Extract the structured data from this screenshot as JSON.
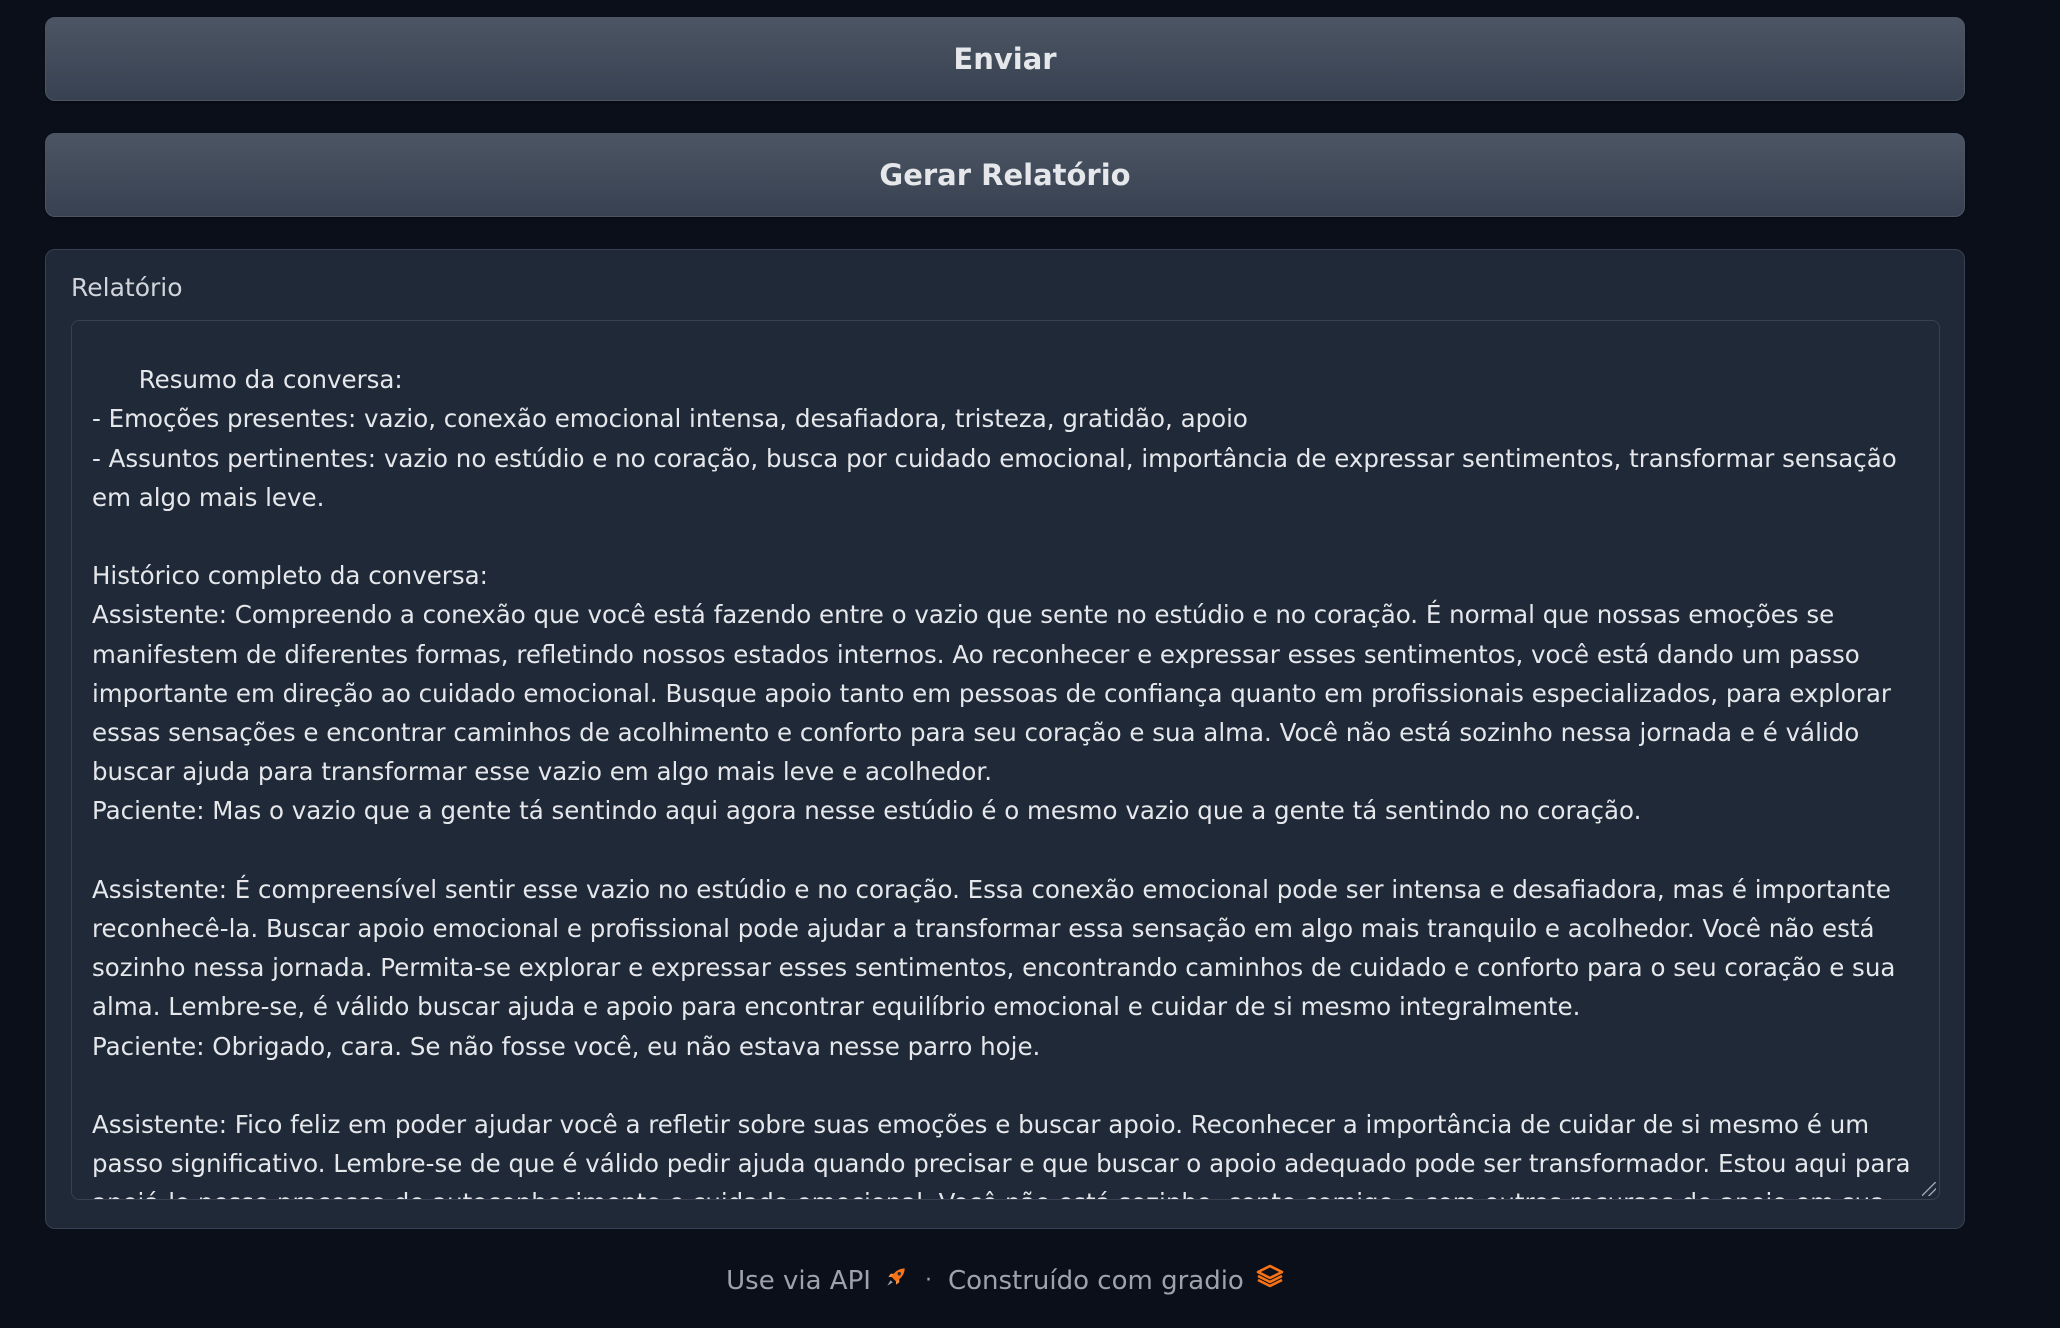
{
  "buttons": {
    "send_label": "Enviar",
    "report_label": "Gerar Relatório"
  },
  "report_panel": {
    "label": "Relatório",
    "text": "Resumo da conversa:\n- Emoções presentes: vazio, conexão emocional intensa, desafiadora, tristeza, gratidão, apoio\n- Assuntos pertinentes: vazio no estúdio e no coração, busca por cuidado emocional, importância de expressar sentimentos, transformar sensação em algo mais leve.\n\nHistórico completo da conversa:\nAssistente: Compreendo a conexão que você está fazendo entre o vazio que sente no estúdio e no coração. É normal que nossas emoções se manifestem de diferentes formas, refletindo nossos estados internos. Ao reconhecer e expressar esses sentimentos, você está dando um passo importante em direção ao cuidado emocional. Busque apoio tanto em pessoas de confiança quanto em profissionais especializados, para explorar essas sensações e encontrar caminhos de acolhimento e conforto para seu coração e sua alma. Você não está sozinho nessa jornada e é válido buscar ajuda para transformar esse vazio em algo mais leve e acolhedor.\nPaciente: Mas o vazio que a gente tá sentindo aqui agora nesse estúdio é o mesmo vazio que a gente tá sentindo no coração.\n\nAssistente: É compreensível sentir esse vazio no estúdio e no coração. Essa conexão emocional pode ser intensa e desafiadora, mas é importante reconhecê-la. Buscar apoio emocional e profissional pode ajudar a transformar essa sensação em algo mais tranquilo e acolhedor. Você não está sozinho nessa jornada. Permita-se explorar e expressar esses sentimentos, encontrando caminhos de cuidado e conforto para o seu coração e sua alma. Lembre-se, é válido buscar ajuda e apoio para encontrar equilíbrio emocional e cuidar de si mesmo integralmente.\nPaciente: Obrigado, cara. Se não fosse você, eu não estava nesse parro hoje.\n\nAssistente: Fico feliz em poder ajudar você a refletir sobre suas emoções e buscar apoio. Reconhecer a importância de cuidar de si mesmo é um passo significativo. Lembre-se de que é válido pedir ajuda quando precisar e que buscar o apoio adequado pode ser transformador. Estou aqui para apoiá-lo nesse processo de autoconhecimento e cuidado emocional. Você não está sozinho, conte comigo e com outros recursos de apoio em sua jornada de autocuidado."
  },
  "footer": {
    "api_label": "Use via API",
    "api_icon": "rocket-icon",
    "separator": "·",
    "built_label": "Construído com gradio",
    "built_icon": "gradio-logo-icon"
  },
  "colors": {
    "background": "#0b0f19",
    "panel": "#1f2937",
    "button": "#4b5563",
    "text": "#e5e7eb",
    "muted": "#9ca3af",
    "accent": "#f97316"
  }
}
